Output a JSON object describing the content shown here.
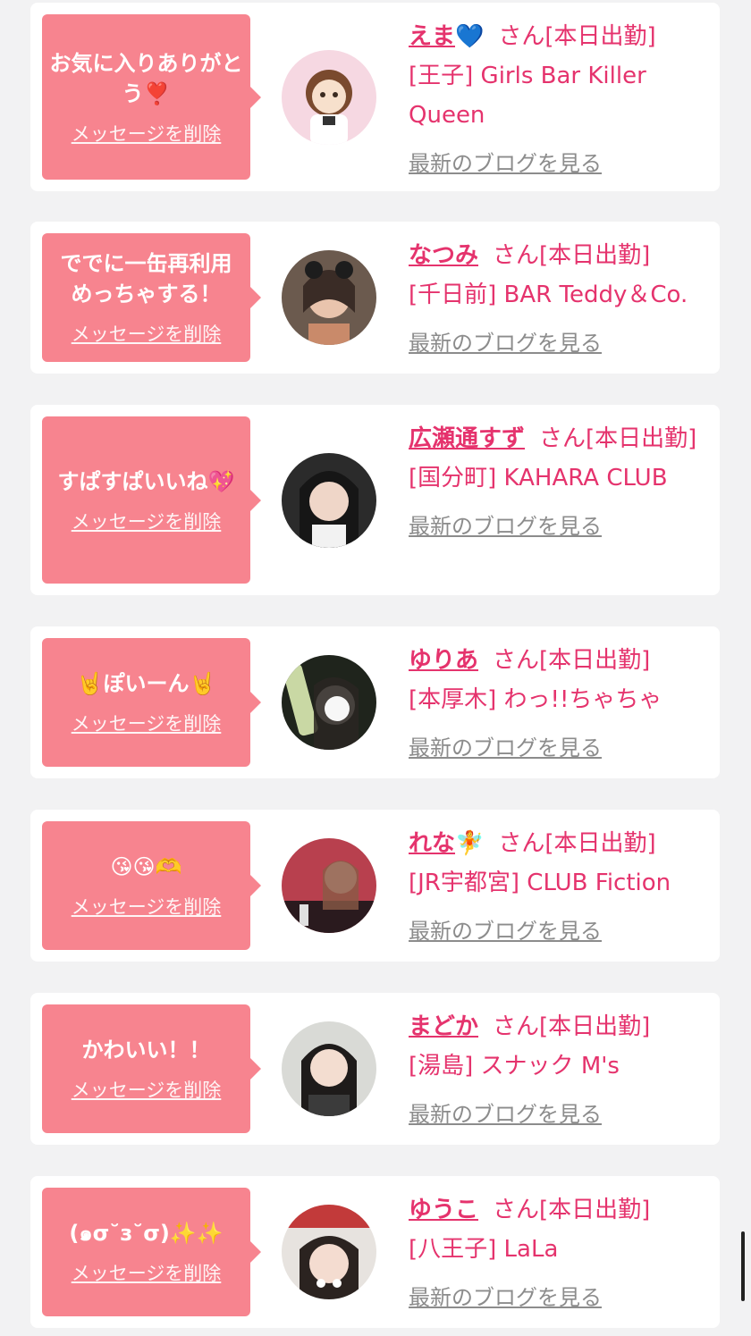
{
  "delete_label": "メッセージを削除",
  "blog_label": "最新のブログを見る",
  "san_label": "さん",
  "status_label": "[本日出勤]",
  "colors": {
    "pink_bubble": "#f7848f",
    "accent": "#e5336d",
    "muted": "#8c8c8c"
  },
  "cards": [
    {
      "message": "お気に入りありがとう❣️",
      "name": "えま",
      "emoji": "💙",
      "shop": "[王子] Girls Bar Killer Queen"
    },
    {
      "message": "ででに一缶再利用めっちゃする！",
      "name": "なつみ",
      "emoji": "",
      "shop": "[千日前] BAR Teddy＆Co."
    },
    {
      "message": "すぱすぱいいね💖",
      "name": "広瀬通すず",
      "emoji": "",
      "shop": "[国分町] KAHARA CLUB"
    },
    {
      "message": "🤘ぽいーん🤘",
      "name": "ゆりあ",
      "emoji": "",
      "shop": "[本厚木] わっ!!ちゃちゃ"
    },
    {
      "message": "😘😘🫶",
      "name": "れな",
      "emoji": "🧚",
      "shop": "[JR宇都宮] CLUB Fiction"
    },
    {
      "message": "かわいい！！",
      "name": "まどか",
      "emoji": "",
      "shop": "[湯島] スナック M's"
    },
    {
      "message": "(๑σ˘з˘σ)✨✨",
      "name": "ゆうこ",
      "emoji": "",
      "shop": "[八王子] LaLa"
    }
  ]
}
